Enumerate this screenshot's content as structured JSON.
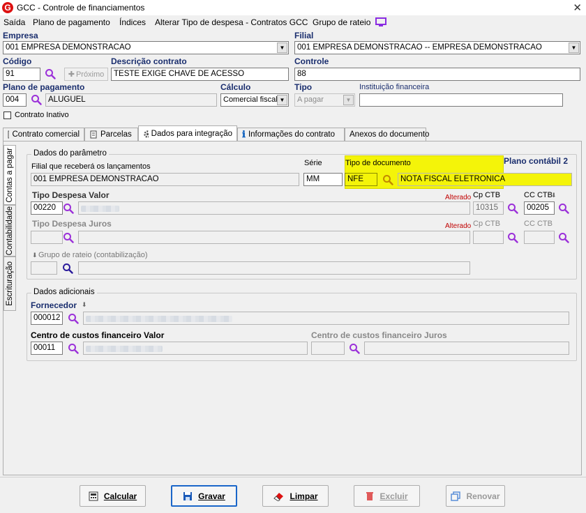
{
  "window": {
    "title": "GCC - Controle de financiamentos",
    "close": "✕"
  },
  "menu": [
    "Saída",
    "Plano de pagamento",
    "Índices",
    "Alterar Tipo de despesa - Contratos GCC",
    "Grupo de rateio"
  ],
  "fields": {
    "empresa": {
      "label": "Empresa",
      "value": "001 EMPRESA DEMONSTRACAO"
    },
    "filial": {
      "label": "Filial",
      "value": "001 EMPRESA DEMONSTRACAO -- EMPRESA DEMONSTRACAO"
    },
    "codigo": {
      "label": "Código",
      "value": "91"
    },
    "proximo": {
      "label": "Próximo"
    },
    "descricao": {
      "label": "Descrição contrato",
      "value": "TESTE EXIGE CHAVE DE ACESSO"
    },
    "controle": {
      "label": "Controle",
      "value": "88"
    },
    "plano": {
      "label": "Plano de pagamento",
      "code": "004",
      "value": "ALUGUEL"
    },
    "calculo": {
      "label": "Cálculo",
      "value": "Comercial fiscal"
    },
    "tipo": {
      "label": "Tipo",
      "value": "A pagar"
    },
    "instituicao": {
      "label": "Instituição financeira",
      "value": ""
    },
    "contrato_inativo": {
      "label": "Contrato Inativo",
      "checked": false
    }
  },
  "tabs": [
    {
      "label": "Contrato comercial",
      "icon": "document-icon"
    },
    {
      "label": "Parcelas",
      "icon": "list-icon"
    },
    {
      "label": "Dados para integração",
      "icon": "gear-icon",
      "active": true
    },
    {
      "label": "Informações do contrato",
      "icon": "info-icon"
    },
    {
      "label": "Anexos do documento",
      "icon": ""
    }
  ],
  "vtabs": [
    "Contas a pagar",
    "Contabilidade",
    "Escrituração"
  ],
  "parametro": {
    "legend": "Dados do parâmetro",
    "filial_label": "Filial que receberá os lançamentos",
    "filial_value": "001 EMPRESA DEMONSTRACAO",
    "serie_label": "Série",
    "serie_value": "MM",
    "tipo_doc_label": "Tipo de documento",
    "tipo_doc_code": "NFE",
    "tipo_doc_value": "NOTA FISCAL ELETRONICA",
    "plano_contabil": "Plano contábil 2",
    "despesa_valor_label": "Tipo Despesa Valor",
    "despesa_valor_code": "00220",
    "alterado1": "Alterado",
    "cp_ctb_label": "Cp CTB",
    "cp_ctb_value": "10315",
    "cc_ctb_label": "CC CTB",
    "cc_ctb_value": "00205",
    "despesa_juros_label": "Tipo Despesa Juros",
    "alterado2": "Alterado",
    "cp_ctb2_label": "Cp CTB",
    "cc_ctb2_label": "CC CTB",
    "grupo_rateio_label": "Grupo de rateio (contabilização)"
  },
  "adicionais": {
    "legend": "Dados adicionais",
    "fornecedor_label": "Fornecedor",
    "fornecedor_code": "000012",
    "cc_valor_label": "Centro de custos financeiro Valor",
    "cc_valor_code": "00011",
    "cc_juros_label": "Centro de custos financeiro Juros"
  },
  "buttons": {
    "calcular": "Calcular",
    "gravar": "Gravar",
    "limpar": "Limpar",
    "excluir": "Excluir",
    "renovar": "Renovar"
  }
}
